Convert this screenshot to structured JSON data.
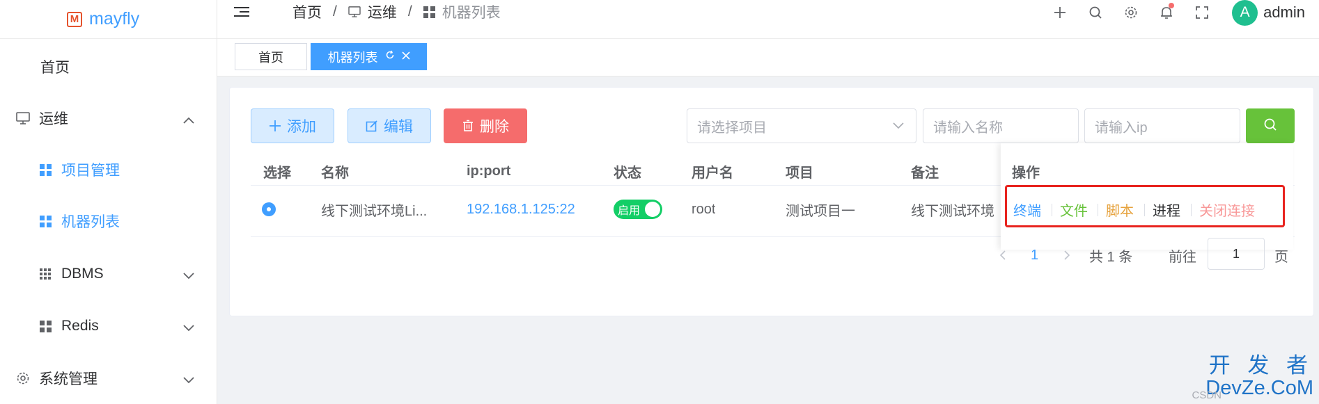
{
  "logo": {
    "mark": "M",
    "title": "mayfly"
  },
  "sidebar": {
    "items": [
      {
        "label": "首页"
      },
      {
        "label": "运维"
      },
      {
        "label": "项目管理"
      },
      {
        "label": "机器列表"
      },
      {
        "label": "DBMS"
      },
      {
        "label": "Redis"
      },
      {
        "label": "系统管理"
      }
    ]
  },
  "header": {
    "breadcrumb": [
      "首页",
      "运维",
      "机器列表"
    ],
    "sep": "/",
    "avatar_letter": "A",
    "username": "admin"
  },
  "tags": [
    {
      "label": "首页"
    },
    {
      "label": "机器列表"
    }
  ],
  "toolbar": {
    "add_label": "添加",
    "edit_label": "编辑",
    "delete_label": "删除",
    "project_placeholder": "请选择项目",
    "name_placeholder": "请输入名称",
    "ip_placeholder": "请输入ip"
  },
  "table": {
    "columns": [
      "选择",
      "名称",
      "ip:port",
      "状态",
      "用户名",
      "项目",
      "备注",
      "操作"
    ],
    "rows": [
      {
        "name": "线下测试环境Li...",
        "ip": "192.168.1.125:22",
        "status": "启用",
        "username": "root",
        "project": "测试项目一",
        "remark": "线下测试环境"
      }
    ],
    "actions": [
      "终端",
      "文件",
      "脚本",
      "进程",
      "关闭连接"
    ]
  },
  "pagination": {
    "current": "1",
    "total": "共 1 条",
    "goto": "前往",
    "page_value": "1",
    "page_unit": "页"
  },
  "watermark": {
    "big": "开 发 者",
    "small": "DevZe.CoM",
    "tiny": "CSDN"
  },
  "colors": {
    "primary": "#409eff",
    "danger": "#f56c6c",
    "success": "#67c23a",
    "highlight": "#e8241f"
  }
}
